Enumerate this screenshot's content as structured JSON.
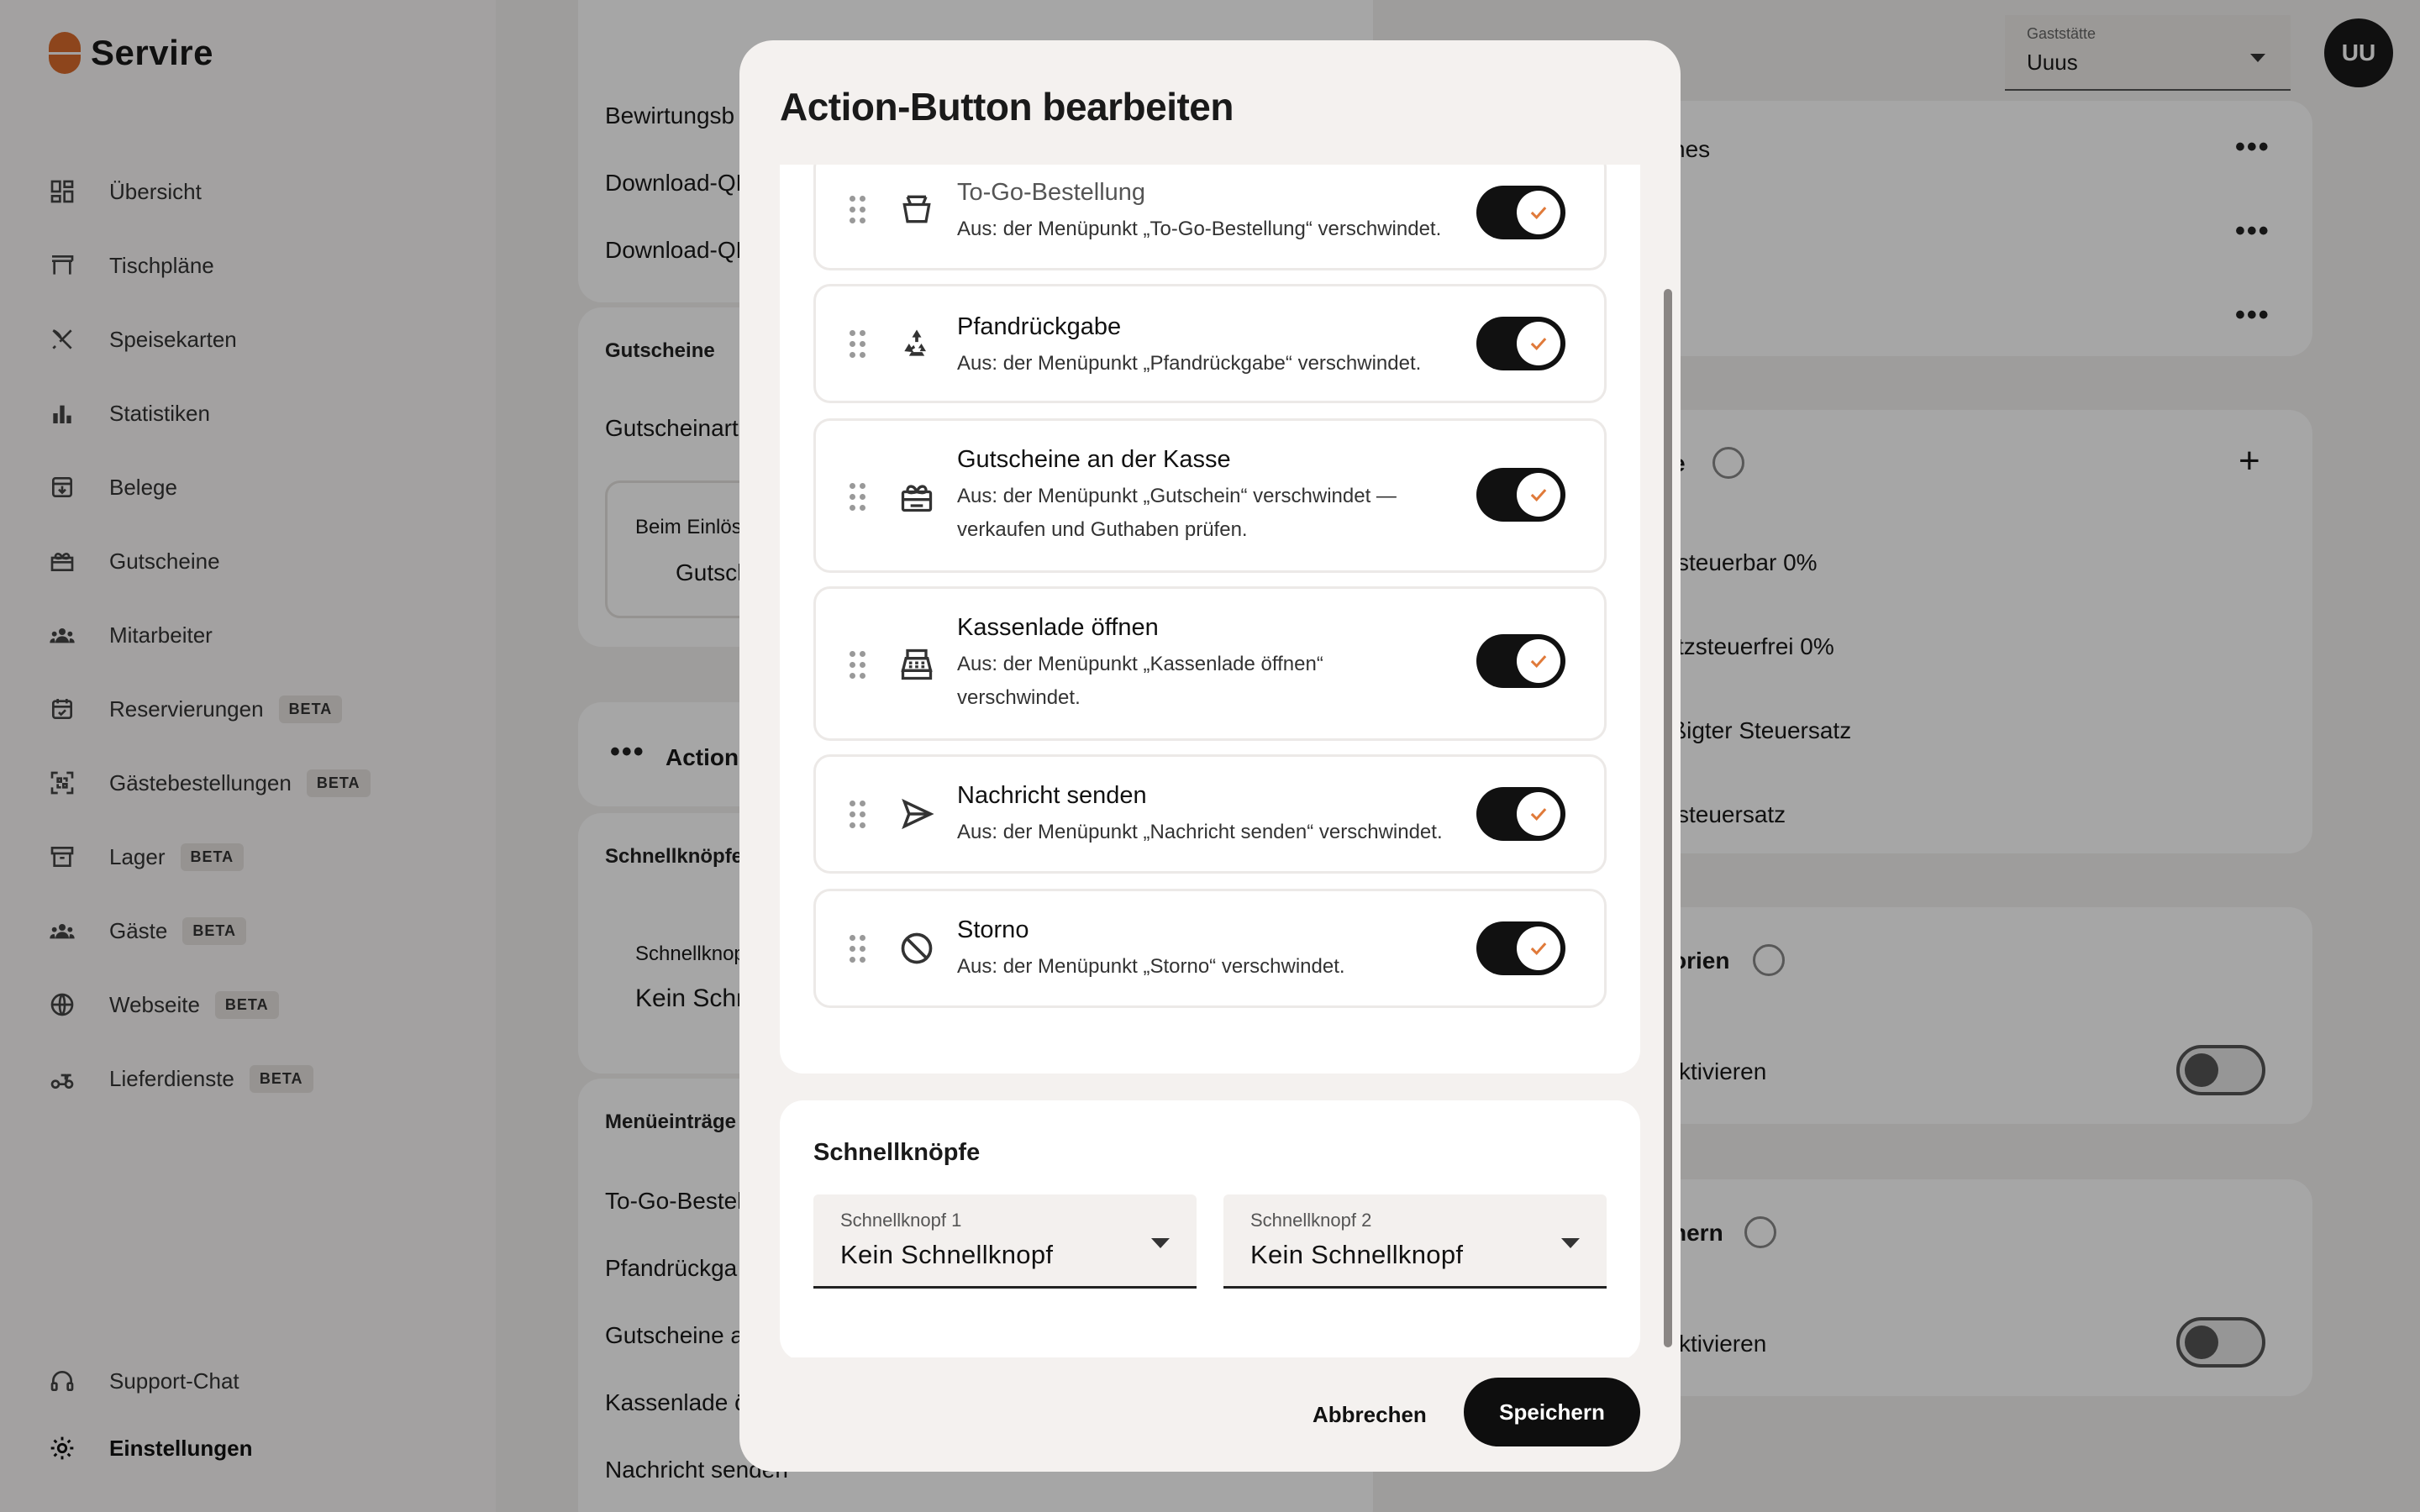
{
  "app": {
    "name": "Servire"
  },
  "sidebar": {
    "items": [
      {
        "label": "Übersicht",
        "icon": "dashboard-icon"
      },
      {
        "label": "Tischpläne",
        "icon": "table-icon"
      },
      {
        "label": "Speisekarten",
        "icon": "cutlery-icon"
      },
      {
        "label": "Statistiken",
        "icon": "bar-chart-icon"
      },
      {
        "label": "Belege",
        "icon": "receipt-icon"
      },
      {
        "label": "Gutscheine",
        "icon": "gift-icon"
      },
      {
        "label": "Mitarbeiter",
        "icon": "team-icon"
      },
      {
        "label": "Reservierungen",
        "icon": "calendar-check-icon",
        "badge": "BETA"
      },
      {
        "label": "Gästebestellungen",
        "icon": "qr-scan-icon",
        "badge": "BETA"
      },
      {
        "label": "Lager",
        "icon": "archive-icon",
        "badge": "BETA"
      },
      {
        "label": "Gäste",
        "icon": "guests-icon",
        "badge": "BETA"
      },
      {
        "label": "Webseite",
        "icon": "globe-icon",
        "badge": "BETA"
      },
      {
        "label": "Lieferdienste",
        "icon": "scooter-icon",
        "badge": "BETA"
      }
    ],
    "bottom": [
      {
        "label": "Support-Chat",
        "icon": "headset-icon"
      },
      {
        "label": "Einstellungen",
        "icon": "gear-icon"
      }
    ]
  },
  "topbar": {
    "venue_label": "Gaststätte",
    "venue_value": "Uuus",
    "avatar_initials": "UU"
  },
  "background": {
    "left": {
      "lines_top": [
        "Bewirtungsb",
        "Download-QF",
        "Download-QF"
      ],
      "vouchers_header": "Gutscheine",
      "voucher_art": "Gutscheinart",
      "redeem_label": "Beim Einlös",
      "redeem_value": "Gutsch",
      "action_label": "Action-",
      "quick_header": "Schnellknöpfe",
      "quick_label": "Schnellknop",
      "quick_value": "Kein Schn",
      "menu_header": "Menüeinträge",
      "menu_items": [
        "To-Go-Bestel",
        "Pfandrückga",
        "Gutscheine a",
        "Kassenlade ö",
        "Nachricht senden"
      ]
    },
    "right": {
      "rows_top": [
        "nes",
        "",
        ""
      ],
      "tax_header": "e",
      "tax_items": [
        "steuerbar 0%",
        "tzsteuerfrei 0%",
        "ßigter Steuersatz",
        "steuersatz"
      ],
      "categories_header": "orien",
      "categories_toggle_label": "ktivieren",
      "printers_header": "hern",
      "printers_toggle_label": "ktivieren"
    }
  },
  "modal": {
    "title": "Action-Button bearbeiten",
    "rows": [
      {
        "title": "To-Go-Bestellung",
        "desc": "Aus: der Menüpunkt „To-Go-Bestellung“ verschwindet.",
        "icon": "takeaway-box-icon",
        "on": true
      },
      {
        "title": "Pfandrückgabe",
        "desc": "Aus: der Menüpunkt „Pfandrückgabe“ verschwindet.",
        "icon": "recycle-icon",
        "on": true
      },
      {
        "title": "Gutscheine an der Kasse",
        "desc": "Aus: der Menüpunkt „Gutschein“ verschwindet — verkaufen und Guthaben prüfen.",
        "icon": "gift-card-icon",
        "on": true
      },
      {
        "title": "Kassenlade öffnen",
        "desc": "Aus: der Menüpunkt „Kassenlade öffnen“ verschwindet.",
        "icon": "cash-register-icon",
        "on": true
      },
      {
        "title": "Nachricht senden",
        "desc": "Aus: der Menüpunkt „Nachricht senden“ verschwindet.",
        "icon": "send-icon",
        "on": true
      },
      {
        "title": "Storno",
        "desc": "Aus: der Menüpunkt „Storno“ verschwindet.",
        "icon": "cancel-circle-icon",
        "on": true
      }
    ],
    "quick": {
      "title": "Schnellknöpfe",
      "button1": {
        "label": "Schnellknopf 1",
        "value": "Kein Schnellknopf"
      },
      "button2": {
        "label": "Schnellknopf 2",
        "value": "Kein Schnellknopf"
      }
    },
    "cancel_label": "Abbrechen",
    "save_label": "Speichern"
  },
  "colors": {
    "brand": "#d96a2b",
    "check": "#e07a3a",
    "primary": "#0e0e0e"
  }
}
